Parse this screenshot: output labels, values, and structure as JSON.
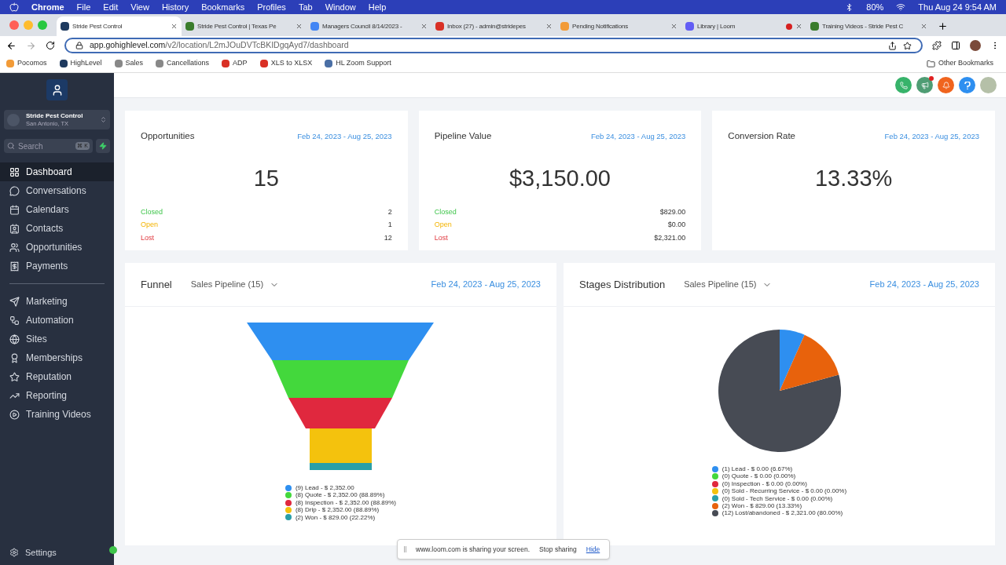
{
  "menu_bar": {
    "app": "Chrome",
    "items": [
      "File",
      "Edit",
      "View",
      "History",
      "Bookmarks",
      "Profiles",
      "Tab",
      "Window",
      "Help"
    ],
    "battery": "80%",
    "clock": "Thu Aug 24  9:54 AM"
  },
  "tabs": [
    {
      "title": "Stride Pest Control",
      "selected": true,
      "color": "#1e3a5f"
    },
    {
      "title": "Stride Pest Control | Texas Pe",
      "selected": false,
      "color": "#3a7d2c"
    },
    {
      "title": "Managers Council 8/14/2023 -",
      "selected": false,
      "color": "#4285f4"
    },
    {
      "title": "Inbox (27) - admin@stridepes",
      "selected": false,
      "color": "#d93025"
    },
    {
      "title": "Pending Notifications",
      "selected": false,
      "color": "#f29b38"
    },
    {
      "title": "Library | Loom",
      "selected": false,
      "color": "#625df5",
      "recording": true
    },
    {
      "title": "Training Videos - Stride Pest C",
      "selected": false,
      "color": "#3a7d2c"
    }
  ],
  "address": {
    "host": "app.gohighlevel.com",
    "path": "/v2/location/L2mJOuDVTcBKIDgqAyd7/dashboard"
  },
  "bookmarks": [
    {
      "label": "Pocomos",
      "color": "#f29b38"
    },
    {
      "label": "HighLevel",
      "color": "#1e3a5f"
    },
    {
      "label": "Sales",
      "color": "#888888"
    },
    {
      "label": "Cancellations",
      "color": "#888888"
    },
    {
      "label": "ADP",
      "color": "#d93025"
    },
    {
      "label": "XLS to XLSX",
      "color": "#d93025"
    },
    {
      "label": "HL Zoom Support",
      "color": "#4a6fa5"
    }
  ],
  "other_bookmarks": "Other Bookmarks",
  "sidebar": {
    "account": {
      "name": "Stride Pest Control",
      "location": "San Antonio, TX"
    },
    "search": {
      "placeholder": "Search",
      "shortcut": "⌘ K"
    },
    "items": [
      {
        "label": "Dashboard",
        "selected": true,
        "kind": "grid"
      },
      {
        "label": "Conversations",
        "selected": false,
        "kind": "chat"
      },
      {
        "label": "Calendars",
        "selected": false,
        "kind": "calendar"
      },
      {
        "label": "Contacts",
        "selected": false,
        "kind": "contacts"
      },
      {
        "label": "Opportunities",
        "selected": false,
        "kind": "people"
      },
      {
        "label": "Payments",
        "selected": false,
        "kind": "receipt"
      }
    ],
    "items2": [
      {
        "label": "Marketing",
        "selected": false,
        "kind": "send"
      },
      {
        "label": "Automation",
        "selected": false,
        "kind": "workflow"
      },
      {
        "label": "Sites",
        "selected": false,
        "kind": "globe"
      },
      {
        "label": "Memberships",
        "selected": false,
        "kind": "award"
      },
      {
        "label": "Reputation",
        "selected": false,
        "kind": "star"
      },
      {
        "label": "Reporting",
        "selected": false,
        "kind": "trend"
      },
      {
        "label": "Training Videos",
        "selected": false,
        "kind": "video"
      }
    ],
    "settings": "Settings"
  },
  "stat_cards": [
    {
      "title": "Opportunities",
      "range": "Feb 24, 2023 - Aug 25, 2023",
      "value": "15",
      "rows": [
        {
          "label": "Closed",
          "value": "2",
          "kind": "closed"
        },
        {
          "label": "Open",
          "value": "1",
          "kind": "open"
        },
        {
          "label": "Lost",
          "value": "12",
          "kind": "lost"
        }
      ]
    },
    {
      "title": "Pipeline Value",
      "range": "Feb 24, 2023 - Aug 25, 2023",
      "value": "$3,150.00",
      "rows": [
        {
          "label": "Closed",
          "value": "$829.00",
          "kind": "closed"
        },
        {
          "label": "Open",
          "value": "$0.00",
          "kind": "open"
        },
        {
          "label": "Lost",
          "value": "$2,321.00",
          "kind": "lost"
        }
      ]
    },
    {
      "title": "Conversion Rate",
      "range": "Feb 24, 2023 - Aug 25, 2023",
      "value": "13.33%"
    }
  ],
  "funnel": {
    "title": "Funnel",
    "pipeline": "Sales Pipeline (15)",
    "range": "Feb 24, 2023 - Aug 25, 2023",
    "legend": [
      {
        "label": "(9) Lead - $ 2,352.00",
        "color": "#2e8ff0"
      },
      {
        "label": "(8) Quote - $ 2,352.00 (88.89%)",
        "color": "#43d83c"
      },
      {
        "label": "(8) Inspection - $ 2,352.00 (88.89%)",
        "color": "#e0283e"
      },
      {
        "label": "(8) Drip - $ 2,352.00 (88.89%)",
        "color": "#f4c20d"
      },
      {
        "label": "(2) Won - $ 829.00 (22.22%)",
        "color": "#2a9fa8"
      }
    ]
  },
  "stages": {
    "title": "Stages Distribution",
    "pipeline": "Sales Pipeline (15)",
    "range": "Feb 24, 2023 - Aug 25, 2023",
    "legend": [
      {
        "label": "(1) Lead - $ 0.00 (6.67%)",
        "color": "#2e8ff0"
      },
      {
        "label": "(0) Quote - $ 0.00 (0.00%)",
        "color": "#43d83c"
      },
      {
        "label": "(0) Inspection - $ 0.00 (0.00%)",
        "color": "#e0283e"
      },
      {
        "label": "(0) Sold - Recurring Service - $ 0.00 (0.00%)",
        "color": "#f4c20d"
      },
      {
        "label": "(0) Sold - Tech Service - $ 0.00 (0.00%)",
        "color": "#2a9fa8"
      },
      {
        "label": "(2) Won - $ 829.00 (13.33%)",
        "color": "#e8620c"
      },
      {
        "label": "(12) Lost/abandoned - $ 2,321.00 (80.00%)",
        "color": "#474b54"
      }
    ]
  },
  "share_banner": {
    "text": "www.loom.com is sharing your screen.",
    "stop": "Stop sharing",
    "hide": "Hide"
  }
}
